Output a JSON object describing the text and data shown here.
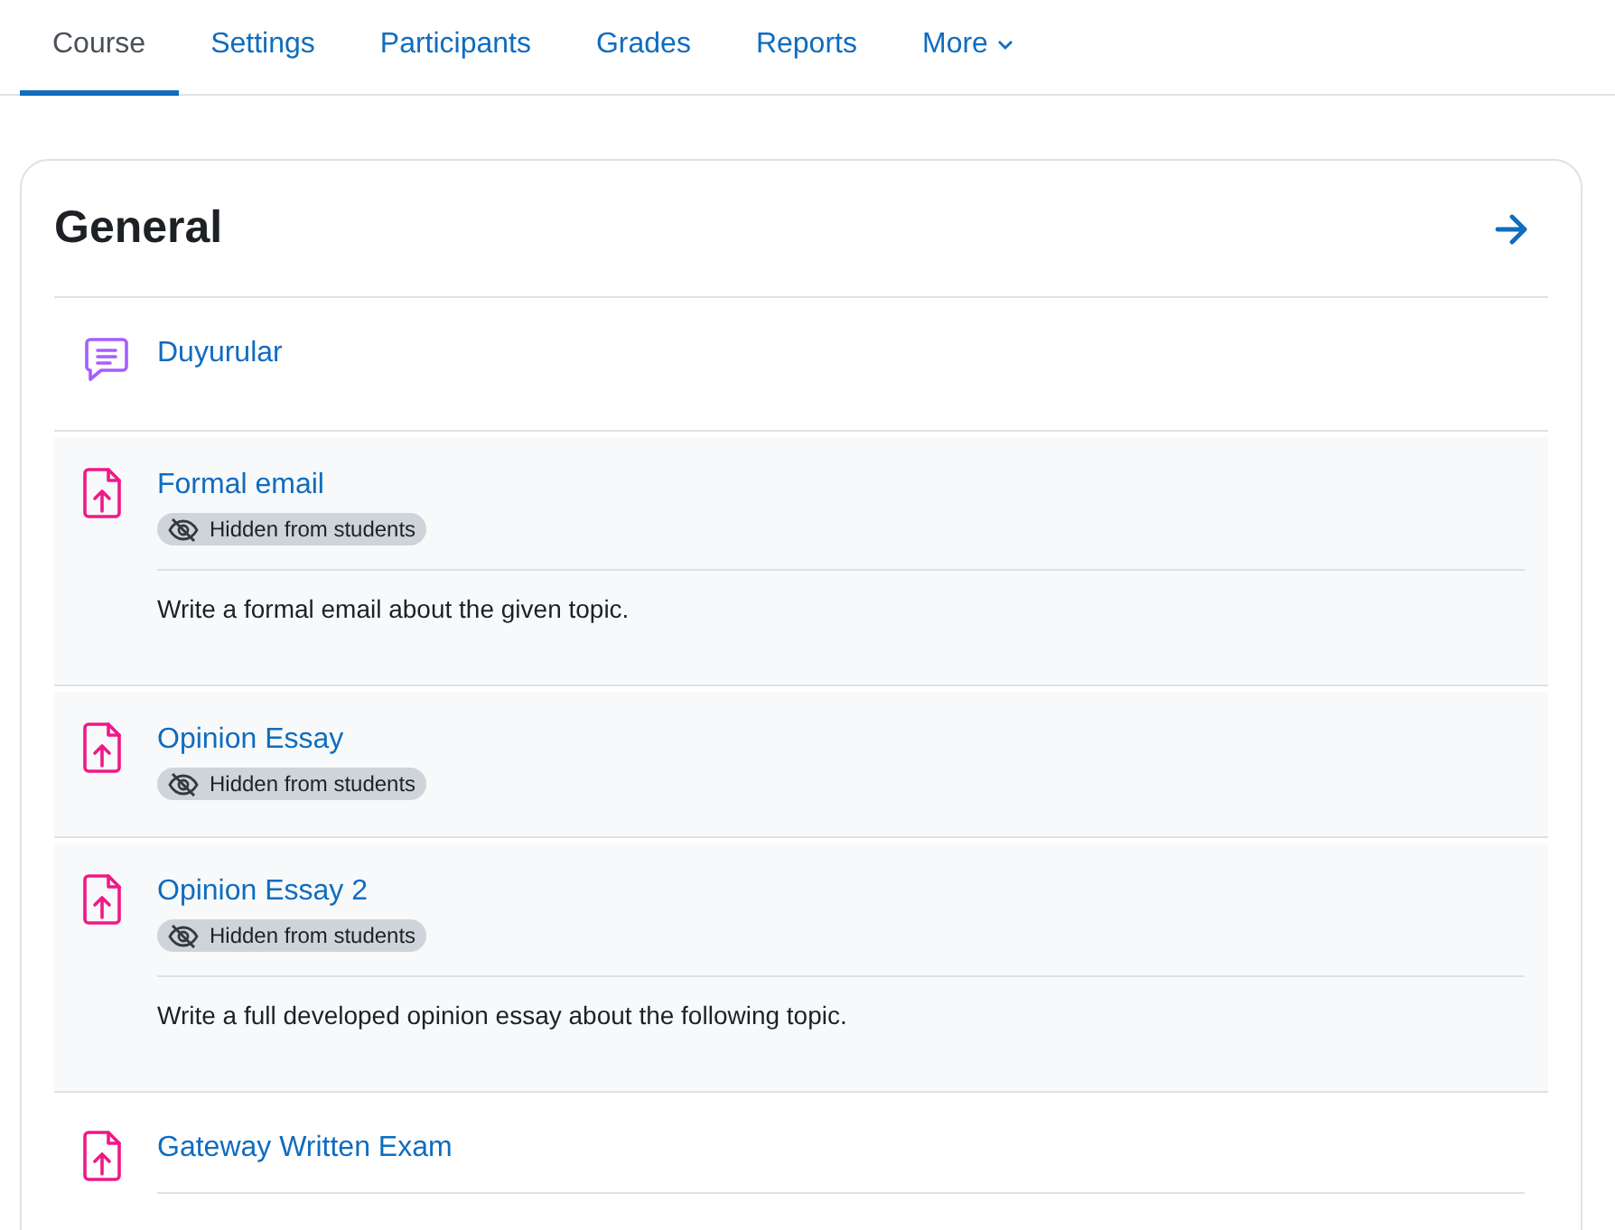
{
  "tabs": [
    {
      "label": "Course",
      "selected": true
    },
    {
      "label": "Settings",
      "selected": false
    },
    {
      "label": "Participants",
      "selected": false
    },
    {
      "label": "Grades",
      "selected": false
    },
    {
      "label": "Reports",
      "selected": false
    },
    {
      "label": "More",
      "selected": false,
      "kind": "dropdown"
    }
  ],
  "section": {
    "title": "General"
  },
  "activities": [
    {
      "kind": "forum",
      "title": "Duyurular",
      "hidden": false
    },
    {
      "kind": "assign",
      "title": "Formal email",
      "hidden": true,
      "badge": "Hidden from students",
      "description": "Write a formal email about the given topic."
    },
    {
      "kind": "assign",
      "title": "Opinion Essay",
      "hidden": true,
      "badge": "Hidden from students"
    },
    {
      "kind": "assign",
      "title": "Opinion Essay 2",
      "hidden": true,
      "badge": "Hidden from students",
      "description": "Write a full developed opinion essay about the following topic."
    },
    {
      "kind": "assign",
      "title": "Gateway Written Exam",
      "hidden": false,
      "divider": true
    }
  ]
}
